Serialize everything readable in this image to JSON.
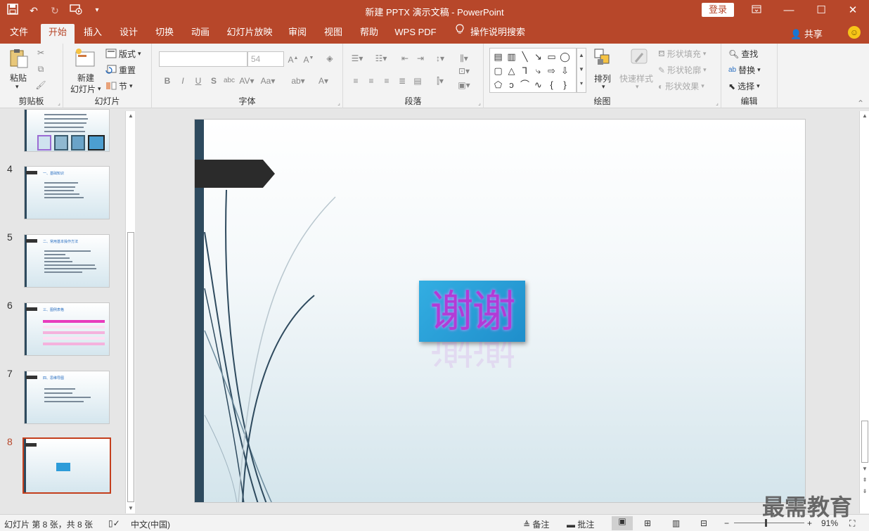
{
  "titlebar": {
    "title": "新建 PPTX 演示文稿  -  PowerPoint",
    "login": "登录",
    "qat_icons": [
      "save-icon",
      "undo-icon",
      "redo-icon",
      "start-slideshow-icon",
      "customize-qat-icon"
    ],
    "window_controls": [
      "ribbon-display-icon",
      "minimize-icon",
      "maximize-icon",
      "close-icon"
    ]
  },
  "tabs": [
    {
      "label": "文件"
    },
    {
      "label": "开始"
    },
    {
      "label": "插入"
    },
    {
      "label": "设计"
    },
    {
      "label": "切换"
    },
    {
      "label": "动画"
    },
    {
      "label": "幻灯片放映"
    },
    {
      "label": "审阅"
    },
    {
      "label": "视图"
    },
    {
      "label": "帮助"
    },
    {
      "label": "WPS PDF"
    },
    {
      "label": "操作说明搜索"
    }
  ],
  "share_label": "共享",
  "ribbon": {
    "clipboard": {
      "label": "剪贴板",
      "paste": "粘贴"
    },
    "slides": {
      "label": "幻灯片",
      "new_slide_1": "新建",
      "new_slide_2": "幻灯片",
      "layout": "版式",
      "reset": "重置",
      "section": "节"
    },
    "font": {
      "label": "字体",
      "font_name": "",
      "font_size": "54"
    },
    "paragraph": {
      "label": "段落"
    },
    "drawing": {
      "label": "绘图",
      "arrange": "排列",
      "quick_styles": "快速样式",
      "shape_fill": "形状填充",
      "shape_outline": "形状轮廓",
      "shape_effects": "形状效果"
    },
    "editing": {
      "label": "编辑",
      "find": "查找",
      "replace": "替换",
      "select": "选择"
    }
  },
  "thumbnails": [
    {
      "num": "",
      "title": ""
    },
    {
      "num": "4",
      "title": "一、基础知识"
    },
    {
      "num": "5",
      "title": "二、常用基本操作方法"
    },
    {
      "num": "6",
      "title": "三、图例表格"
    },
    {
      "num": "7",
      "title": "四、思维导图"
    },
    {
      "num": "8",
      "title": ""
    }
  ],
  "slide": {
    "thanks": "谢谢"
  },
  "status": {
    "slide_info": "幻灯片 第 8 张，共 8 张",
    "language": "中文(中国)",
    "notes": "备注",
    "comments": "批注",
    "zoom": "91%"
  },
  "watermark": "最需教育"
}
